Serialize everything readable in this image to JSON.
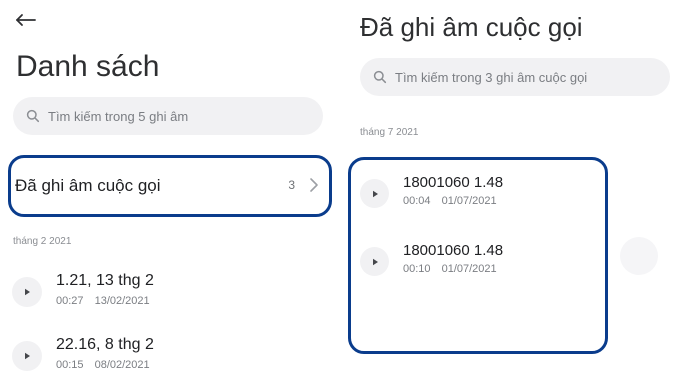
{
  "left_panel": {
    "title": "Danh sách",
    "search": {
      "placeholder": "Tìm kiếm trong 5 ghi âm"
    },
    "folder": {
      "title": "Đã ghi âm cuộc gọi",
      "count": "3"
    },
    "section_label": "tháng 2 2021",
    "records": [
      {
        "title": "1.21, 13 thg 2",
        "duration": "00:27",
        "date": "13/02/2021"
      },
      {
        "title": "22.16, 8 thg 2",
        "duration": "00:15",
        "date": "08/02/2021"
      }
    ]
  },
  "right_panel": {
    "title": "Đã ghi âm cuộc gọi",
    "search": {
      "placeholder": "Tìm kiếm trong 3 ghi âm cuộc gọi"
    },
    "section_label": "tháng 7 2021",
    "records": [
      {
        "title": "18001060 1.48",
        "duration": "00:04",
        "date": "01/07/2021"
      },
      {
        "title": "18001060 1.48",
        "duration": "00:10",
        "date": "01/07/2021"
      }
    ]
  },
  "icons": {
    "back": "back-arrow-icon",
    "search": "search-icon",
    "chevron": "chevron-right-icon",
    "play": "play-icon"
  },
  "colors": {
    "highlight": "#0a3c8c",
    "search_background": "#f1f1f3",
    "text_primary": "#202124",
    "text_secondary": "#7b7e83"
  }
}
